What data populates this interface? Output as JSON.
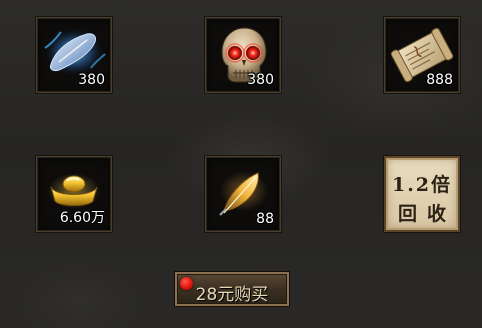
{
  "rewards": [
    {
      "icon": "blue-crystal-icon",
      "quantity": "380"
    },
    {
      "icon": "red-eyed-skull-icon",
      "quantity": "380"
    },
    {
      "icon": "scroll-icon",
      "quantity": "888"
    },
    {
      "icon": "gold-ingot-icon",
      "quantity": "6.60万"
    },
    {
      "icon": "golden-feather-icon",
      "quantity": "88"
    }
  ],
  "recycle": {
    "line1": "1.2倍",
    "line2": "回收"
  },
  "purchase": {
    "label": "28元购买",
    "has_notification_dot": true,
    "notification_color": "#e0140a"
  },
  "colors": {
    "background": "#2a2927",
    "slot_border": "#4a3f2e",
    "recycle_bg": "#e2d3b3",
    "button_text": "#e7d8b4"
  }
}
